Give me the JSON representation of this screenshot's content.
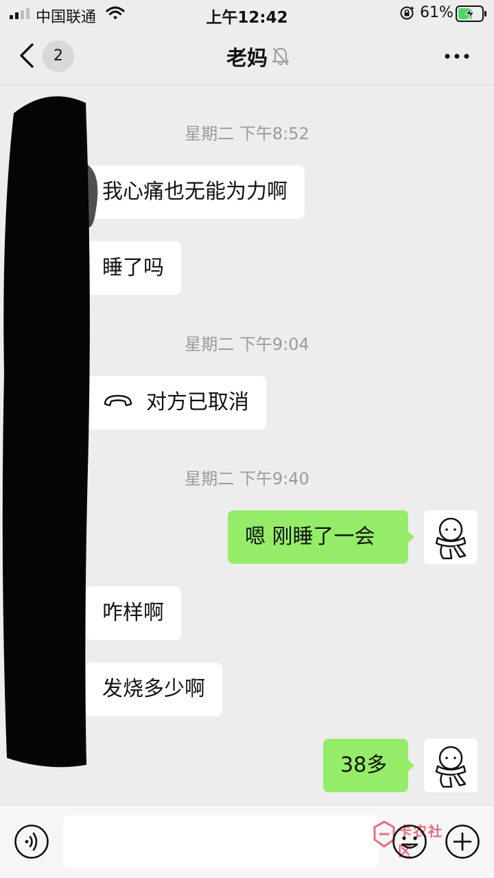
{
  "status_bar": {
    "carrier": "中国联通",
    "time": "上午12:42",
    "battery_percent": "61%",
    "battery_level": 0.61
  },
  "nav": {
    "unread_count": "2",
    "title": "老妈",
    "back_icon": "chevron-left-icon",
    "mute_icon": "bell-off-icon",
    "more_icon": "ellipsis-icon"
  },
  "messages": [
    {
      "type": "timestamp",
      "text": "星期二 下午8:52"
    },
    {
      "type": "message",
      "sender": "other",
      "text": "我心痛也无能为力啊"
    },
    {
      "type": "message",
      "sender": "other",
      "text": "睡了吗"
    },
    {
      "type": "timestamp",
      "text": "星期二 下午9:04"
    },
    {
      "type": "call",
      "sender": "other",
      "icon": "phone-hangup-icon",
      "text": "对方已取消"
    },
    {
      "type": "timestamp",
      "text": "星期二 下午9:40"
    },
    {
      "type": "message",
      "sender": "self",
      "text": "嗯  刚睡了一会"
    },
    {
      "type": "message",
      "sender": "other",
      "text": "咋样啊"
    },
    {
      "type": "message",
      "sender": "other",
      "text": "发烧多少啊"
    },
    {
      "type": "message",
      "sender": "self",
      "text": "38多"
    }
  ],
  "input_bar": {
    "voice_icon": "voice-icon",
    "input_value": "",
    "emoji_icon": "emoji-icon",
    "plus_icon": "plus-icon"
  },
  "watermark": {
    "text": "卡农社区"
  },
  "colors": {
    "background": "#ededed",
    "self_bubble": "#95ec69",
    "other_bubble": "#ffffff",
    "timestamp_text": "#9b9b9b"
  }
}
